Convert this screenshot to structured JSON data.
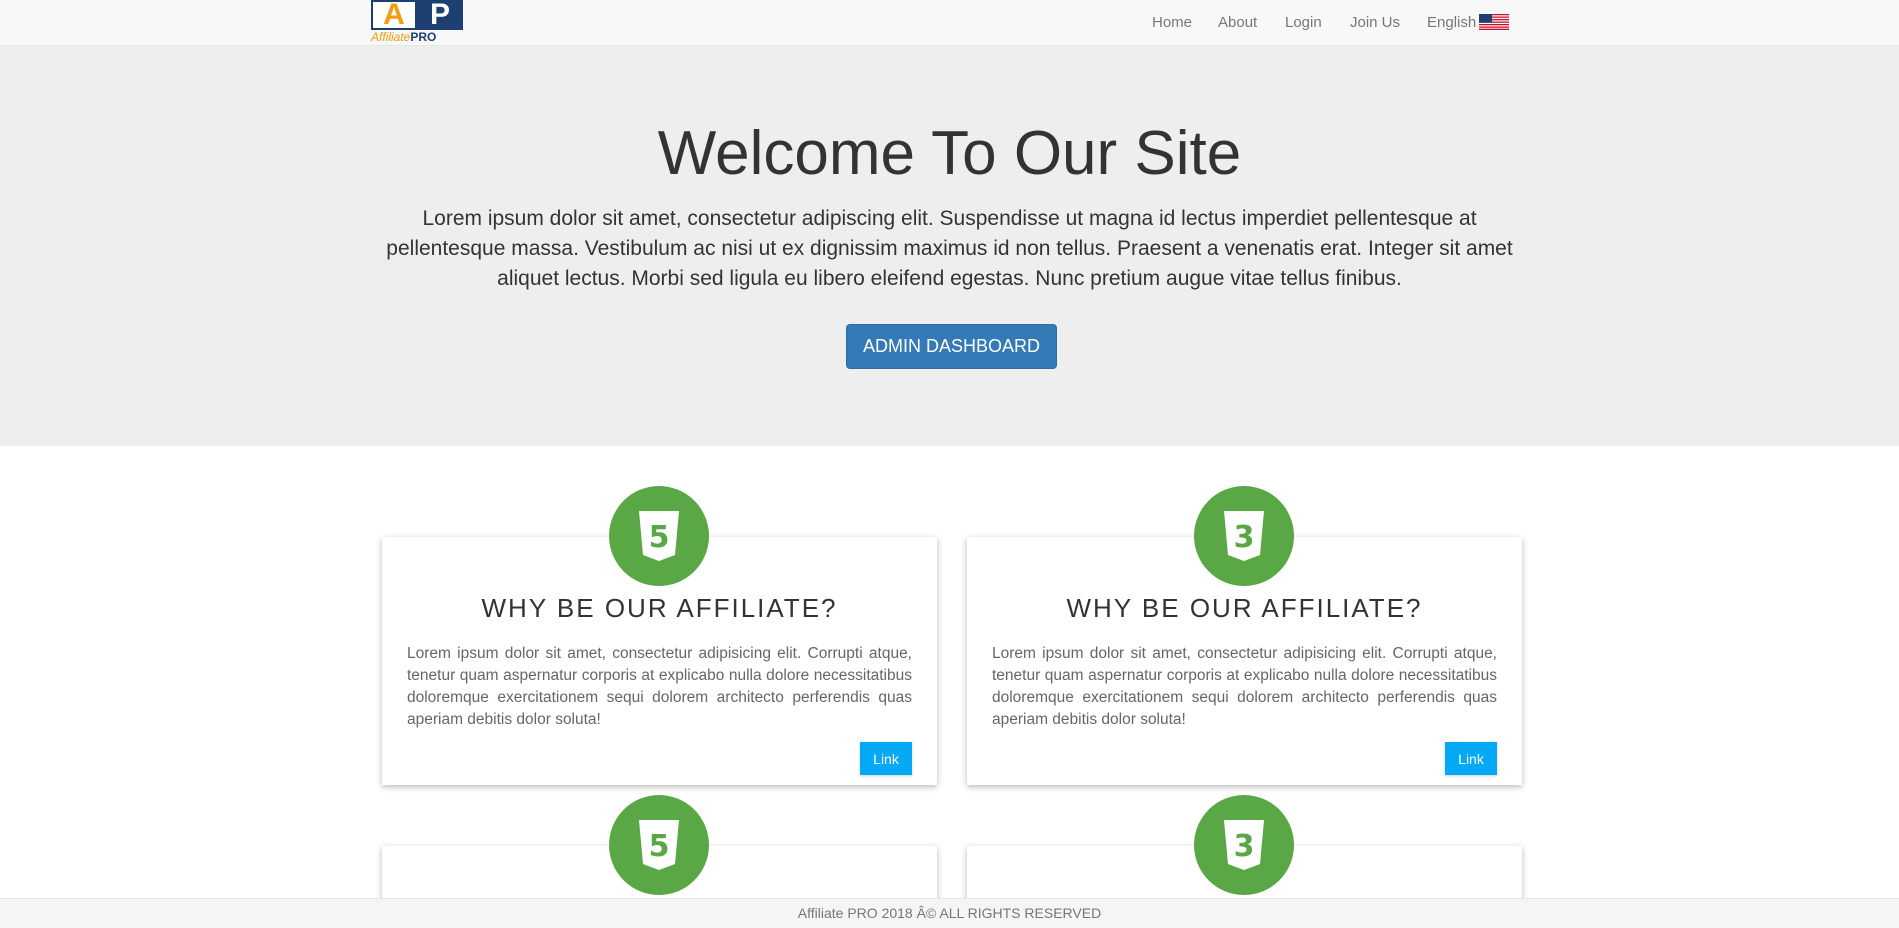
{
  "brand": {
    "logo_letter_a": "A",
    "logo_letter_p": "P",
    "logo_text_1": "Affiliate",
    "logo_text_2": "PRO",
    "colors": {
      "orange": "#f39c12",
      "navy": "#1d3f72"
    }
  },
  "nav": {
    "items": [
      "Home",
      "About",
      "Login",
      "Join Us"
    ],
    "language_label": "English",
    "language_icon": "us-flag-icon"
  },
  "hero": {
    "title": "Welcome To Our Site",
    "body": "Lorem ipsum dolor sit amet, consectetur adipiscing elit. Suspendisse ut magna id lectus imperdiet pellentesque at pellentesque massa. Vestibulum ac nisi ut ex dignissim maximus id non tellus. Praesent a venenatis erat. Integer sit amet aliquet lectus. Morbi sed ligula eu libero eleifend egestas. Nunc pretium augue vitae tellus finibus.",
    "button_label": "ADMIN DASHBOARD",
    "button_color": "#337ab7"
  },
  "cards": [
    {
      "icon": "html5-icon",
      "icon_glyph": "5",
      "title": "WHY BE OUR AFFILIATE?",
      "text": "Lorem ipsum dolor sit amet, consectetur adipisicing elit. Corrupti atque, tenetur quam aspernatur corporis at explicabo nulla dolore necessitatibus doloremque exercitationem sequi dolorem architecto perferendis quas aperiam debitis dolor soluta!",
      "link_label": "Link"
    },
    {
      "icon": "css3-icon",
      "icon_glyph": "3",
      "title": "WHY BE OUR AFFILIATE?",
      "text": "Lorem ipsum dolor sit amet, consectetur adipisicing elit. Corrupti atque, tenetur quam aspernatur corporis at explicabo nulla dolore necessitatibus doloremque exercitationem sequi dolorem architecto perferendis quas aperiam debitis dolor soluta!",
      "link_label": "Link"
    },
    {
      "icon": "html5-icon",
      "icon_glyph": "5"
    },
    {
      "icon": "css3-icon",
      "icon_glyph": "3"
    }
  ],
  "colors": {
    "badge_green": "#5aa845",
    "link_blue": "#03a9f4",
    "hero_bg": "#eeeeee"
  },
  "footer": {
    "text": "Affiliate PRO 2018 Â© ALL RIGHTS RESERVED"
  }
}
